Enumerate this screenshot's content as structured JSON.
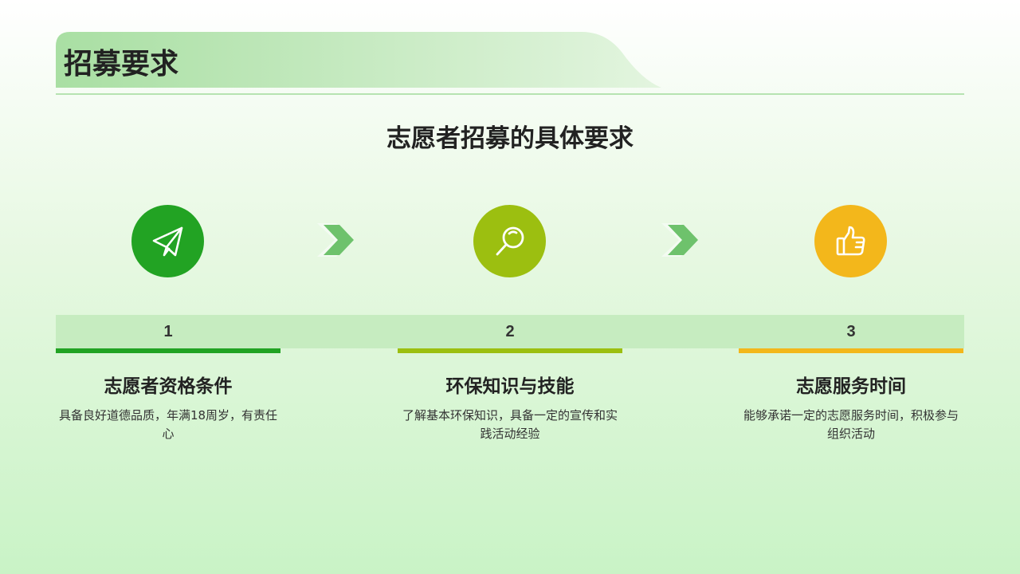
{
  "header": {
    "title": "招募要求"
  },
  "subtitle": "志愿者招募的具体要求",
  "colors": {
    "green": "#22a323",
    "lime": "#9cbf10",
    "amber": "#f3b71b",
    "arrow": "#6ec26c",
    "band": "#c6ecc0"
  },
  "steps": [
    {
      "number": "1",
      "icon": "paper-plane-icon",
      "title": "志愿者资格条件",
      "description": "具备良好道德品质，年满18周岁，有责任心"
    },
    {
      "number": "2",
      "icon": "magnifier-icon",
      "title": "环保知识与技能",
      "description": "了解基本环保知识，具备一定的宣传和实践活动经验"
    },
    {
      "number": "3",
      "icon": "thumbs-up-icon",
      "title": "志愿服务时间",
      "description": "能够承诺一定的志愿服务时间，积极参与组织活动"
    }
  ]
}
